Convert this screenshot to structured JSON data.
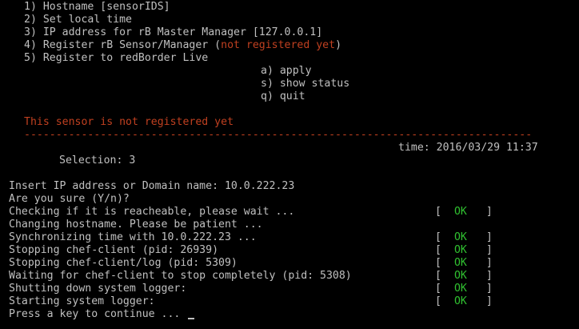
{
  "menu": {
    "items": [
      "1) Hostname [sensorIDS]",
      "2) Set local time",
      "3) IP address for rB Master Manager [127.0.0.1]",
      "5) Register to redBorder Live"
    ],
    "register_item_prefix": "4) Register rB Sensor/Manager (",
    "register_item_status": "not registered yet",
    "register_item_suffix": ")",
    "actions": [
      "a) apply",
      "s) show status",
      "q) quit"
    ]
  },
  "status": {
    "message": "This sensor is not registered yet",
    "separator": "--------------------------------------------------------------------------------",
    "time": "time: 2016/03/29 11:37",
    "selection": "Selection: 3"
  },
  "log": {
    "lines": [
      "Insert IP address or Domain name: 10.0.222.23",
      "Are you sure (Y/n)?",
      "Checking if it is reacheable, please wait ...",
      "Changing hostname. Please be patient ...",
      "Synchronizing time with 10.0.222.23 ...",
      "Stopping chef-client (pid: 26939)",
      "Stopping chef-client/log (pid: 5309)",
      "Waiting for chef-client to stop completely (pid: 5308)",
      "Shutting down system logger:",
      "Starting system logger:"
    ],
    "prompt": "Press a key to continue ...",
    "ok_open": "[",
    "ok_text": "OK",
    "ok_close": "]"
  },
  "colors": {
    "background": "#000000",
    "foreground": "#c0c0c0",
    "warning": "#c04020",
    "ok": "#30c030"
  }
}
